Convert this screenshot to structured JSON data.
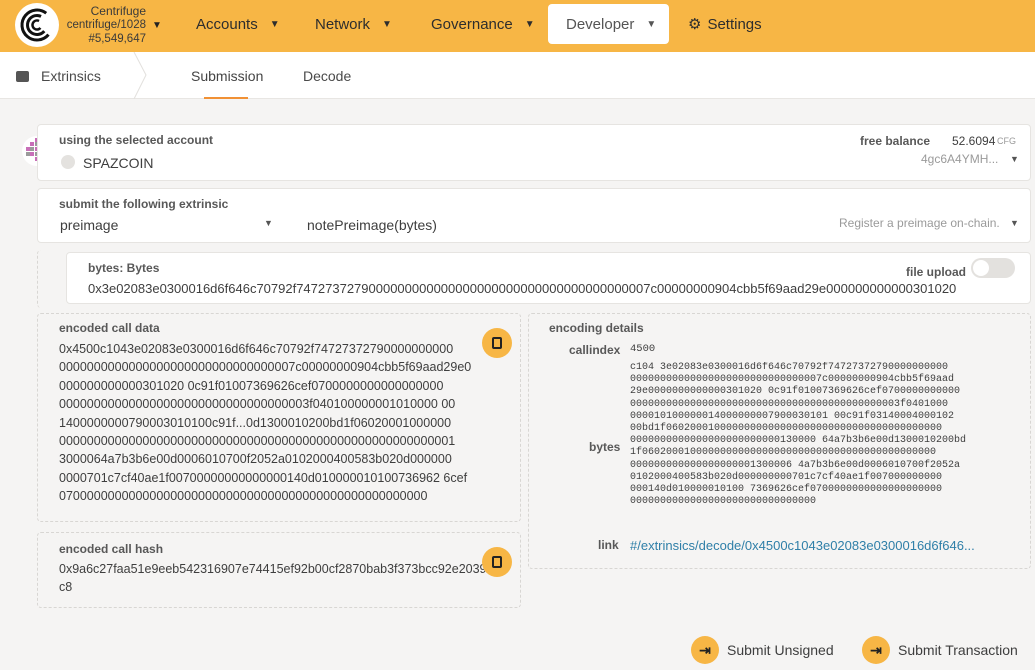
{
  "chain": {
    "name": "Centrifuge",
    "spec": "centrifuge/1028",
    "block": "#5,549,647"
  },
  "nav": {
    "accounts": "Accounts",
    "network": "Network",
    "governance": "Governance",
    "developer": "Developer",
    "settings": "Settings"
  },
  "tabs": {
    "section": "Extrinsics",
    "submission": "Submission",
    "decode": "Decode"
  },
  "account": {
    "label": "using the selected account",
    "name": "SPAZCOIN",
    "free_balance_label": "free balance",
    "free_balance_value": "52.6094",
    "free_balance_unit": "CFG",
    "address_short": "4gc6A4YMH..."
  },
  "extrinsic": {
    "label": "submit the following extrinsic",
    "pallet": "preimage",
    "method": "notePreimage(bytes)",
    "description": "Register a preimage on-chain."
  },
  "bytes_param": {
    "label": "bytes: Bytes",
    "file_upload": "file upload",
    "value": "0x3e02083e0300016d6f646c70792f7472737279000000000000000000000000000000000000007c00000000904cbb5f69aad29e000000000000301020"
  },
  "encoded_call_data": {
    "label": "encoded call data",
    "lines": [
      "0x4500c1043e02083e0300016d6f646c70792f74727372790000000000",
      "0000000000000000000000000000000007c00000000904cbb5f69aad29e0",
      "000000000000301020 0c91f01007369626cef0700000000000000000",
      "000000000000000000000000000000000003f040100000001010000 00",
      "1400000000790003010100c91f...0d1300010200bd1f06020001000000",
      "000000000000000000000000000000000000000000000000000000001",
      "3000064a7b3b6e00d0006010700f2052a0102000400583b020d000000",
      "0000701c7cf40ae1f00700000000000000140d010000010100736962 6cef",
      "07000000000000000000000000000000000000000000000000000"
    ]
  },
  "encoded_call_hash": {
    "label": "encoded call hash",
    "value": "0x9a6c27faa51e9eeb542316907e74415ef92b00cf2870bab3f373bcc92e2039c8"
  },
  "encoding_details": {
    "label": "encoding details",
    "callindex_label": "callindex",
    "callindex_value": "4500",
    "bytes_label": "bytes",
    "bytes_lines": [
      "c104 3e02083e0300016d6f646c70792f74727372790000000000",
      "00000000000000000000000000000007c00000000904cbb5f69aad",
      "29e0000000000000301020 0c91f01007369626cef0700000000000",
      "000000000000000000000000000000000000000000003f0401000",
      "000010100000014000000007900030101 00c91f03140004000102",
      "00bd1f0602000100000000000000000000000000000000000000",
      "0000000000000000000000000130000 64a7b3b6e00d1300010200bd",
      "1f0602000100000000000000000000000000000000000000000",
      "000000000000000000001300006 4a7b3b6e00d0006010700f2052a",
      "0102000400583b020d000000000701c7cf40ae1f007000000000",
      "000140d010000010100 7369626cef0700000000000000000000",
      "0000000000000000000000000000000"
    ],
    "link_label": "link",
    "link_value": "#/extrinsics/decode/0x4500c1043e02083e0300016d6f646..."
  },
  "actions": {
    "submit_unsigned": "Submit Unsigned",
    "submit_transaction": "Submit Transaction"
  },
  "colors": {
    "accent": "#f7b645",
    "link": "#2f7fa8"
  },
  "icons": [
    "centrifuge-logo-icon",
    "caret-down-icon",
    "gear-icon",
    "extrinsics-icon",
    "copy-icon",
    "sign-in-icon"
  ]
}
